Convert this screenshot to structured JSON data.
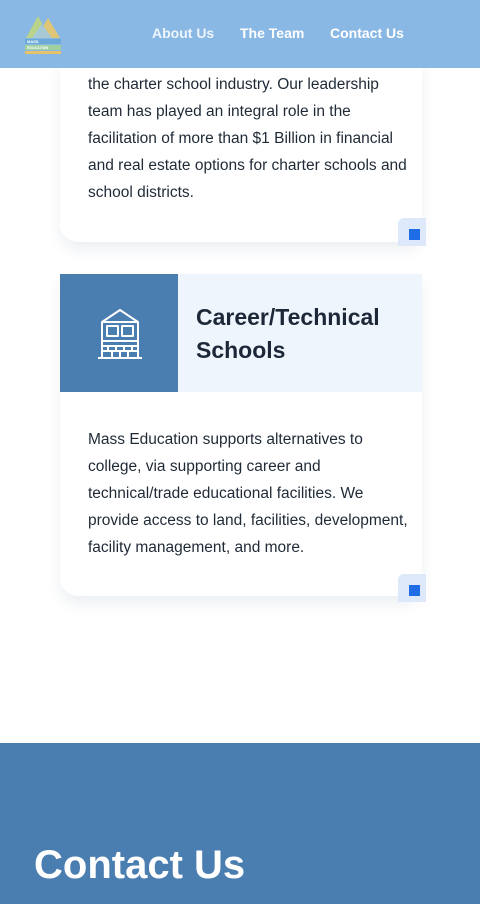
{
  "header": {
    "logo_text_top": "MASS",
    "logo_text_bottom": "EDUCATION",
    "nav": [
      {
        "label": "About Us"
      },
      {
        "label": "The Team"
      },
      {
        "label": "Contact Us"
      }
    ]
  },
  "cards": [
    {
      "body": "the charter school industry. Our leadership team has played an integral role in the facilitation of more than $1 Billion in financial and real estate options for charter schools and school districts."
    },
    {
      "title": "Career/Technical Schools",
      "icon": "school-building-icon",
      "body": "Mass Education supports alternatives to college, via supporting career and technical/trade educational facilities. We provide access to land, facilities, development, facility management, and more."
    }
  ],
  "contact": {
    "title": "Contact Us"
  },
  "colors": {
    "header_bg": "#8ab8e4",
    "accent_blue": "#4a7db0",
    "card_head_bg": "#eff5fd",
    "corner_square": "#1e6ce6"
  }
}
